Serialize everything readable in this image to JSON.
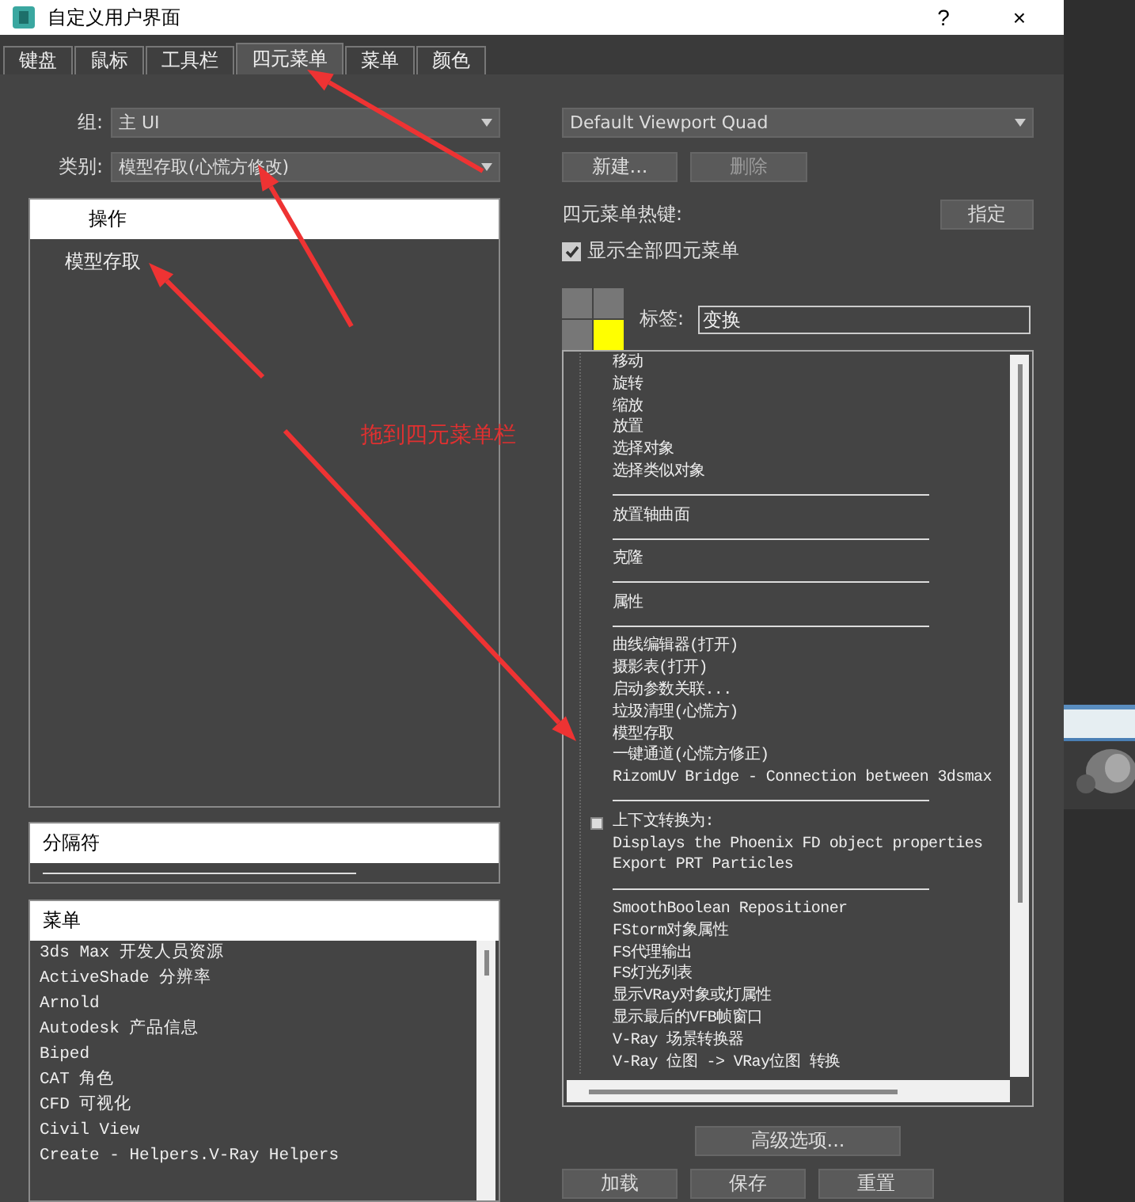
{
  "window": {
    "title": "自定义用户界面",
    "help": "?",
    "close": "×"
  },
  "tabs": [
    {
      "label": "键盘",
      "selected": false
    },
    {
      "label": "鼠标",
      "selected": false
    },
    {
      "label": "工具栏",
      "selected": false
    },
    {
      "label": "四元菜单",
      "selected": true
    },
    {
      "label": "菜单",
      "selected": false
    },
    {
      "label": "颜色",
      "selected": false
    }
  ],
  "left": {
    "group": {
      "label": "组:",
      "value": "主 UI"
    },
    "category": {
      "label": "类别:",
      "value": "模型存取(心慌方修改)"
    },
    "actions": {
      "header": "操作",
      "items": [
        "模型存取"
      ]
    },
    "separators": {
      "header": "分隔符"
    },
    "menus": {
      "header": "菜单",
      "items": [
        "3ds Max 开发人员资源",
        "ActiveShade 分辨率",
        "Arnold",
        "Autodesk 产品信息",
        "Biped",
        "CAT 角色",
        "CFD 可视化",
        "Civil View",
        "Create - Helpers.V-Ray Helpers"
      ]
    }
  },
  "right": {
    "quad_menu": "Default Viewport Quad",
    "new_button": {
      "label": "新建...",
      "disabled": false
    },
    "delete_button": {
      "label": "删除",
      "disabled": true
    },
    "hotkey_label": "四元菜单热键:",
    "assign_button": "指定",
    "show_all": {
      "label": "显示全部四元菜单",
      "checked": true
    },
    "quads": [
      {
        "selected": false
      },
      {
        "selected": false
      },
      {
        "selected": false
      },
      {
        "selected": true
      }
    ],
    "tag_label": "标签:",
    "tag_value": "变换",
    "tree": [
      {
        "kind": "item",
        "label": "移动"
      },
      {
        "kind": "item",
        "label": "旋转"
      },
      {
        "kind": "item",
        "label": "缩放"
      },
      {
        "kind": "item",
        "label": "放置"
      },
      {
        "kind": "item",
        "label": "选择对象"
      },
      {
        "kind": "item",
        "label": "选择类似对象"
      },
      {
        "kind": "separator"
      },
      {
        "kind": "item",
        "label": "放置轴曲面"
      },
      {
        "kind": "separator"
      },
      {
        "kind": "item",
        "label": "克隆"
      },
      {
        "kind": "separator"
      },
      {
        "kind": "item",
        "label": "属性"
      },
      {
        "kind": "separator"
      },
      {
        "kind": "item",
        "label": "曲线编辑器(打开)"
      },
      {
        "kind": "item",
        "label": "摄影表(打开)"
      },
      {
        "kind": "item",
        "label": "启动参数关联..."
      },
      {
        "kind": "item",
        "label": "垃圾清理(心慌方)"
      },
      {
        "kind": "item",
        "label": "模型存取"
      },
      {
        "kind": "item",
        "label": "一键通道(心慌方修正)"
      },
      {
        "kind": "item",
        "label": "RizomUV Bridge - Connection between 3dsmax"
      },
      {
        "kind": "separator"
      },
      {
        "kind": "submenu",
        "label": "上下文转换为:",
        "expanded": false
      },
      {
        "kind": "item",
        "label": "Displays the Phoenix FD object properties"
      },
      {
        "kind": "item",
        "label": "Export PRT Particles"
      },
      {
        "kind": "separator"
      },
      {
        "kind": "item",
        "label": "SmoothBoolean Repositioner"
      },
      {
        "kind": "item",
        "label": "FStorm对象属性"
      },
      {
        "kind": "item",
        "label": "FS代理输出"
      },
      {
        "kind": "item",
        "label": "FS灯光列表"
      },
      {
        "kind": "item",
        "label": "显示VRay对象或灯属性"
      },
      {
        "kind": "item",
        "label": "显示最后的VFB帧窗口"
      },
      {
        "kind": "item",
        "label": "V-Ray 场景转换器"
      },
      {
        "kind": "item",
        "label": "V-Ray 位图 -> VRay位图 转换"
      }
    ],
    "advanced_button": "高级选项...",
    "bottom_buttons": [
      "加载",
      "保存",
      "重置"
    ]
  },
  "annotation": {
    "text": "拖到四元菜单栏"
  }
}
